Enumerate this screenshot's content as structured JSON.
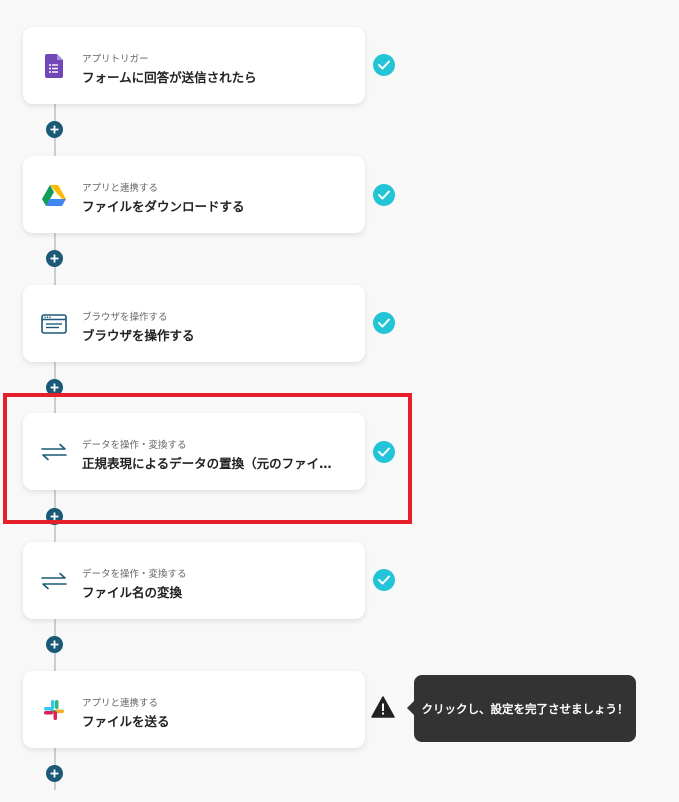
{
  "steps": [
    {
      "subtitle": "アプリトリガー",
      "title": "フォームに回答が送信されたら",
      "icon": "google-forms-icon",
      "status": "complete"
    },
    {
      "subtitle": "アプリと連携する",
      "title": "ファイルをダウンロードする",
      "icon": "google-drive-icon",
      "status": "complete"
    },
    {
      "subtitle": "ブラウザを操作する",
      "title": "ブラウザを操作する",
      "icon": "browser-icon",
      "status": "complete"
    },
    {
      "subtitle": "データを操作・変換する",
      "title": "正規表現によるデータの置換（元のファイ…",
      "icon": "convert-arrows-icon",
      "status": "complete"
    },
    {
      "subtitle": "データを操作・変換する",
      "title": "ファイル名の変換",
      "icon": "convert-arrows-icon",
      "status": "complete"
    },
    {
      "subtitle": "アプリと連携する",
      "title": "ファイルを送る",
      "icon": "slack-icon",
      "status": "warning"
    }
  ],
  "tooltip": {
    "text": "クリックし、設定を完了させましょう！"
  },
  "colors": {
    "check": "#23c4d6",
    "plus": "#1b5a76",
    "highlight": "#e5202a",
    "tooltip_bg": "#333333"
  }
}
